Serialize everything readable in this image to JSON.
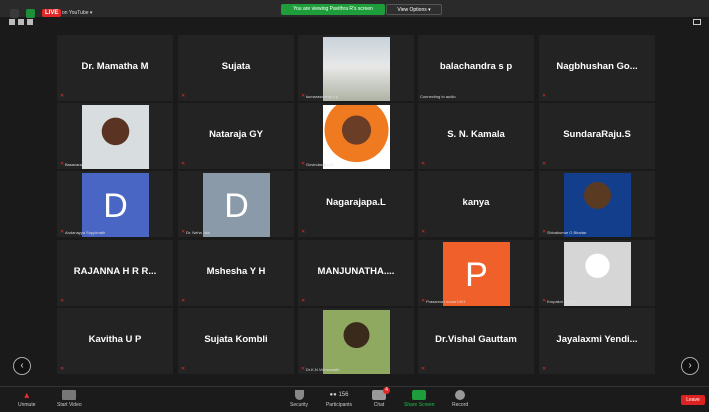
{
  "topbar": {
    "live_label": "LIVE",
    "youtube_label": "on YouTube",
    "banner": "You are viewing Pavithra R's screen",
    "view_options": "View Options"
  },
  "participants": [
    {
      "name": "Dr. Mamatha M"
    },
    {
      "name": "Sujata"
    },
    {
      "name": "",
      "label": "kumaraswamy.s.p"
    },
    {
      "name": "balachandra s p",
      "label": "Connecting to audio"
    },
    {
      "name": "Nagbhushan  Go..."
    },
    {
      "name": "",
      "label": "Basavaraj Kumbar"
    },
    {
      "name": "Nataraja GY"
    },
    {
      "name": "",
      "label": "Govindaraju LG"
    },
    {
      "name": "S. N. Kamala"
    },
    {
      "name": "SundaraRaju.S"
    },
    {
      "name": "",
      "label": "Andanayya Soppimath",
      "avatar": "D"
    },
    {
      "name": "",
      "label": "Dr. Neha Jain",
      "avatar": "D"
    },
    {
      "name": "Nagarajapa.L"
    },
    {
      "name": "kanya"
    },
    {
      "name": "",
      "label": "Shivakumar G Biradar"
    },
    {
      "name": "RAJANNA  H R R..."
    },
    {
      "name": "Mshesha Y H"
    },
    {
      "name": "MANJUNATHA...."
    },
    {
      "name": "",
      "label": "Prasanna Leonar1401",
      "avatar": "P"
    },
    {
      "name": "",
      "label": "Krupakni Naidu"
    },
    {
      "name": "Kavitha U P"
    },
    {
      "name": "Sujata Kombli"
    },
    {
      "name": "",
      "label": "Dr.K.N Vishwanath"
    },
    {
      "name": "Dr.Vishal Gauttam"
    },
    {
      "name": "Jayalaxmi  Yendi..."
    }
  ],
  "toolbar": {
    "unmute": "Unmute",
    "start_video": "Start Video",
    "security": "Security",
    "participants": "Participants",
    "participants_count": "156",
    "chat": "Chat",
    "chat_badge": "4",
    "share_screen": "Share Screen",
    "record": "Record",
    "leave": "Leave"
  },
  "colors": {
    "share_green": "#1e9e3a",
    "leave_red": "#d22222",
    "avatar_blue": "#4a66c4",
    "avatar_gray": "#8a9aa8",
    "avatar_orange": "#f0602a"
  }
}
